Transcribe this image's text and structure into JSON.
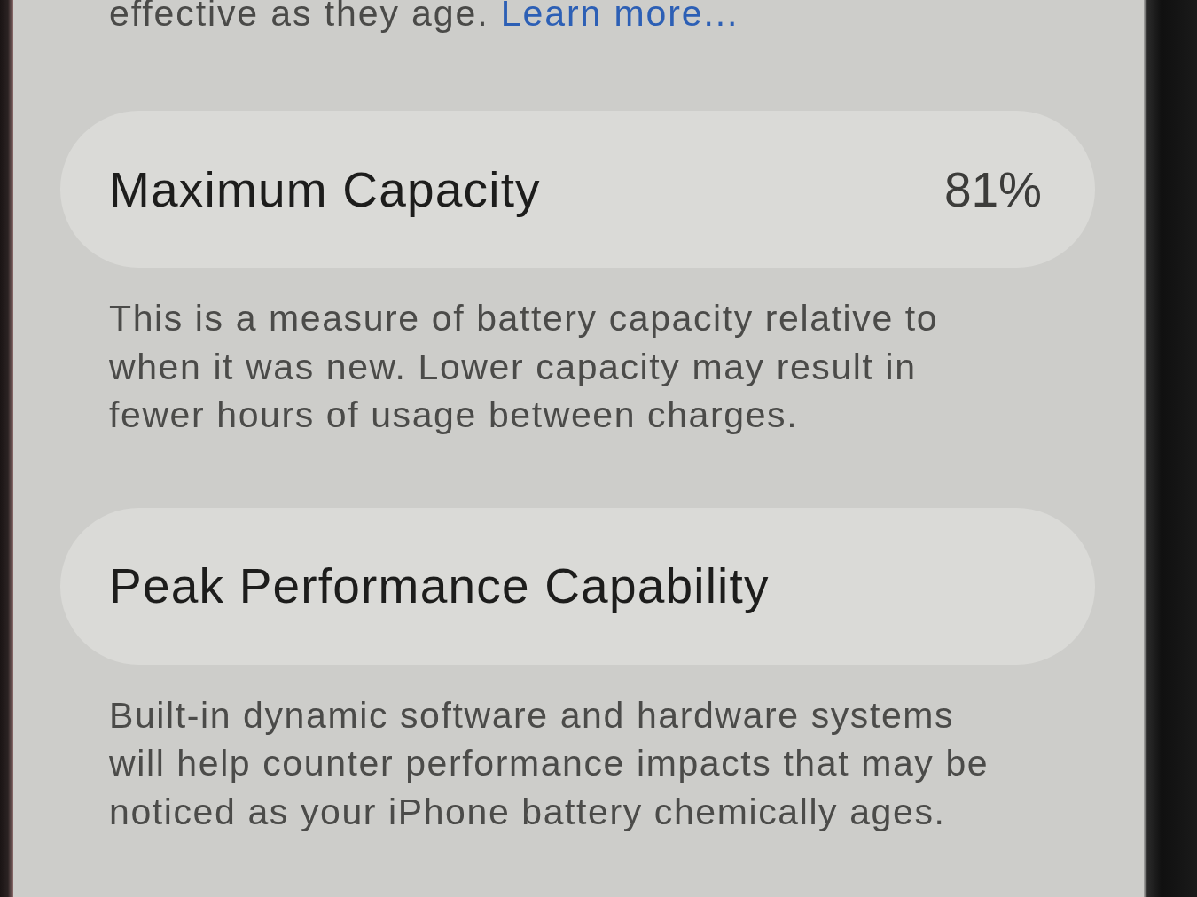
{
  "intro": {
    "text": "effective as they age.",
    "link": "Learn more..."
  },
  "rows": [
    {
      "label": "Maximum Capacity",
      "value": "81%",
      "description": "This is a measure of battery capacity relative to when it was new. Lower capacity may result in fewer hours of usage between charges."
    },
    {
      "label": "Peak Performance Capability",
      "description": "Built-in dynamic software and hardware systems will help counter performance impacts that may be noticed as your iPhone battery chemically ages."
    }
  ]
}
